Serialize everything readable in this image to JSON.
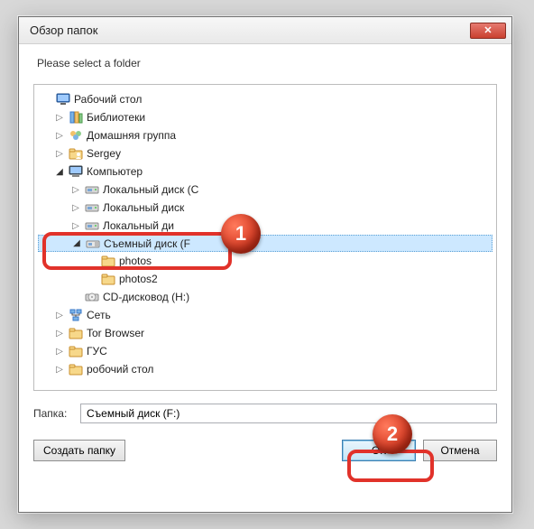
{
  "window": {
    "title": "Обзор папок",
    "close_icon_label": "✕"
  },
  "prompt": "Please select a folder",
  "tree": {
    "desktop": "Рабочий стол",
    "libraries": "Библиотеки",
    "homegroup": "Домашняя группа",
    "user": "Sergey",
    "computer": "Компьютер",
    "local_c": "Локальный диск (C",
    "local_d": "Локальный диск",
    "local_e": "Локальный ди",
    "removable_f": "Съемный диск (F",
    "photos": "photos",
    "photos2": "photos2",
    "cdrom_h": "CD-дисковод (H:)",
    "network": "Сеть",
    "tor": "Tor Browser",
    "gus": "ГУС",
    "desktop2": "робочий стол"
  },
  "folder_field": {
    "label": "Папка:",
    "value": "Съемный диск (F:)"
  },
  "buttons": {
    "new_folder": "Создать папку",
    "ok": "ОК",
    "cancel": "Отмена"
  },
  "annotations": {
    "one": "1",
    "two": "2"
  },
  "icons": {
    "close": "close-icon",
    "desktop": "desktop-icon",
    "libraries": "libraries-icon",
    "homegroup": "homegroup-icon",
    "user": "user-folder-icon",
    "computer": "computer-icon",
    "hdd": "hdd-icon",
    "removable": "removable-drive-icon",
    "folder": "folder-icon",
    "cdrom": "cdrom-icon",
    "network": "network-icon",
    "expand": "chevron-right-icon",
    "collapse": "chevron-down-icon"
  }
}
